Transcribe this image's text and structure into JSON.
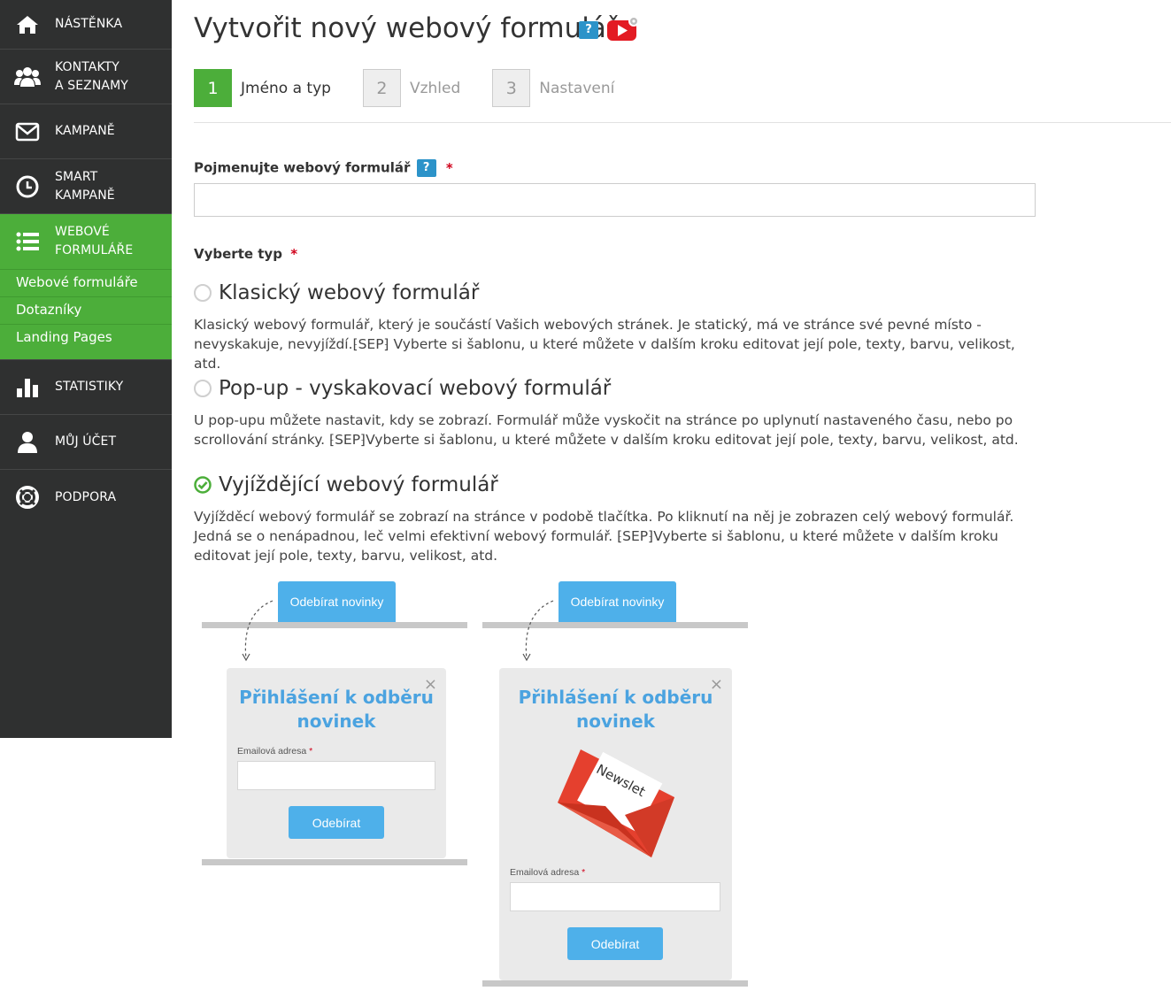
{
  "sidebar": {
    "items": [
      {
        "label": "NÁSTĚNKA",
        "icon": "home-icon"
      },
      {
        "label_line1": "KONTAKTY",
        "label_line2": "A SEZNAMY",
        "icon": "users-icon"
      },
      {
        "label": "KAMPANĚ",
        "icon": "envelope-icon"
      },
      {
        "label_line1": "SMART",
        "label_line2": "KAMPANĚ",
        "icon": "clock-icon"
      },
      {
        "label_line1": "WEBOVÉ",
        "label_line2": "FORMULÁŘE",
        "icon": "list-icon"
      },
      {
        "label": "STATISTIKY",
        "icon": "bar-chart-icon"
      },
      {
        "label": "MŮJ ÚČET",
        "icon": "user-icon"
      },
      {
        "label": "PODPORA",
        "icon": "lifebuoy-icon"
      }
    ],
    "submenu": [
      "Webové formuláře",
      "Dotazníky",
      "Landing Pages"
    ],
    "active_color": "#4cae3a",
    "bg_color": "#2f3030"
  },
  "header": {
    "title": "Vytvořit nový webový formulář",
    "help": "?"
  },
  "steps": [
    {
      "num": "1",
      "label": "Jméno a typ",
      "active": true
    },
    {
      "num": "2",
      "label": "Vzhled",
      "active": false
    },
    {
      "num": "3",
      "label": "Nastavení",
      "active": false
    }
  ],
  "form": {
    "name_label": "Pojmenujte webový formulář",
    "name_help": "?",
    "required_mark": "*",
    "name_value": "",
    "type_label": "Vyberte typ",
    "options": [
      {
        "title": "Klasický webový formulář",
        "desc": "Klasický webový formulář, který je součástí Vašich webových stránek. Je statický, má ve stránce své pevné místo - nevyskakuje, nevyjíždí.⁅SEP⁆ Vyberte si šablonu, u které můžete v dalším kroku editovat její pole, texty, barvu, velikost, atd.",
        "selected": false
      },
      {
        "title": "Pop-up - vyskakovací webový formulář",
        "desc": "U pop-upu můžete nastavit, kdy se zobrazí. Formulář může vyskočit na stránce po uplynutí nastaveného času, nebo po scrollování stránky. ⁅SEP⁆Vyberte si šablonu, u které můžete v dalším kroku editovat její pole, texty, barvu, velikost, atd.",
        "selected": false
      },
      {
        "title": "Vyjíždějící webový formulář",
        "desc": "Vyjížděcí webový formulář se zobrazí na stránce v podobě tlačítka. Po kliknutí na něj je zobrazen celý webový formulář. Jedná se o nenápadnou, leč velmi efektivní webový formulář. ⁅SEP⁆Vyberte si šablonu, u které můžete v dalším kroku editovat její pole, texty, barvu, velikost, atd.",
        "selected": true
      }
    ]
  },
  "previews": [
    {
      "cta": "Odebírat novinky",
      "title_line1": "Přihlášení k odběru",
      "title_line2": "novinek",
      "email_label": "Emailová adresa",
      "required_mark": "*",
      "button": "Odebírat",
      "close": "×"
    },
    {
      "cta": "Odebírat novinky",
      "title_line1": "Přihlášení k odběru",
      "title_line2": "novinek",
      "envelope_text": "Newslet",
      "email_label": "Emailová adresa",
      "required_mark": "*",
      "button": "Odebírat",
      "close": "×"
    }
  ]
}
